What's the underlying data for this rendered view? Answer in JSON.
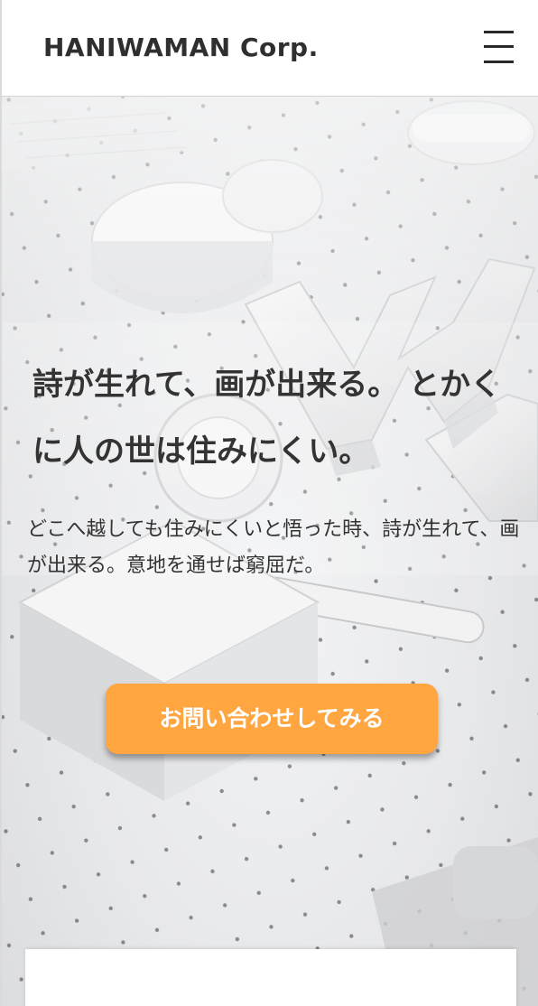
{
  "header": {
    "logo": "HANIWAMAN Corp.",
    "menu_icon": "hamburger-menu-icon"
  },
  "hero": {
    "headline": "詩が生れて、画が出来る。 とかくに人の世は住みにくい。",
    "subtext": "どこへ越しても住みにくいと悟った時、詩が生れて、画が出来る。意地を通せば窮屈だ。",
    "cta_label": "お問い合わせしてみる"
  },
  "colors": {
    "accent": "#ffa640",
    "text": "#333333",
    "header_bg": "#ffffff"
  }
}
